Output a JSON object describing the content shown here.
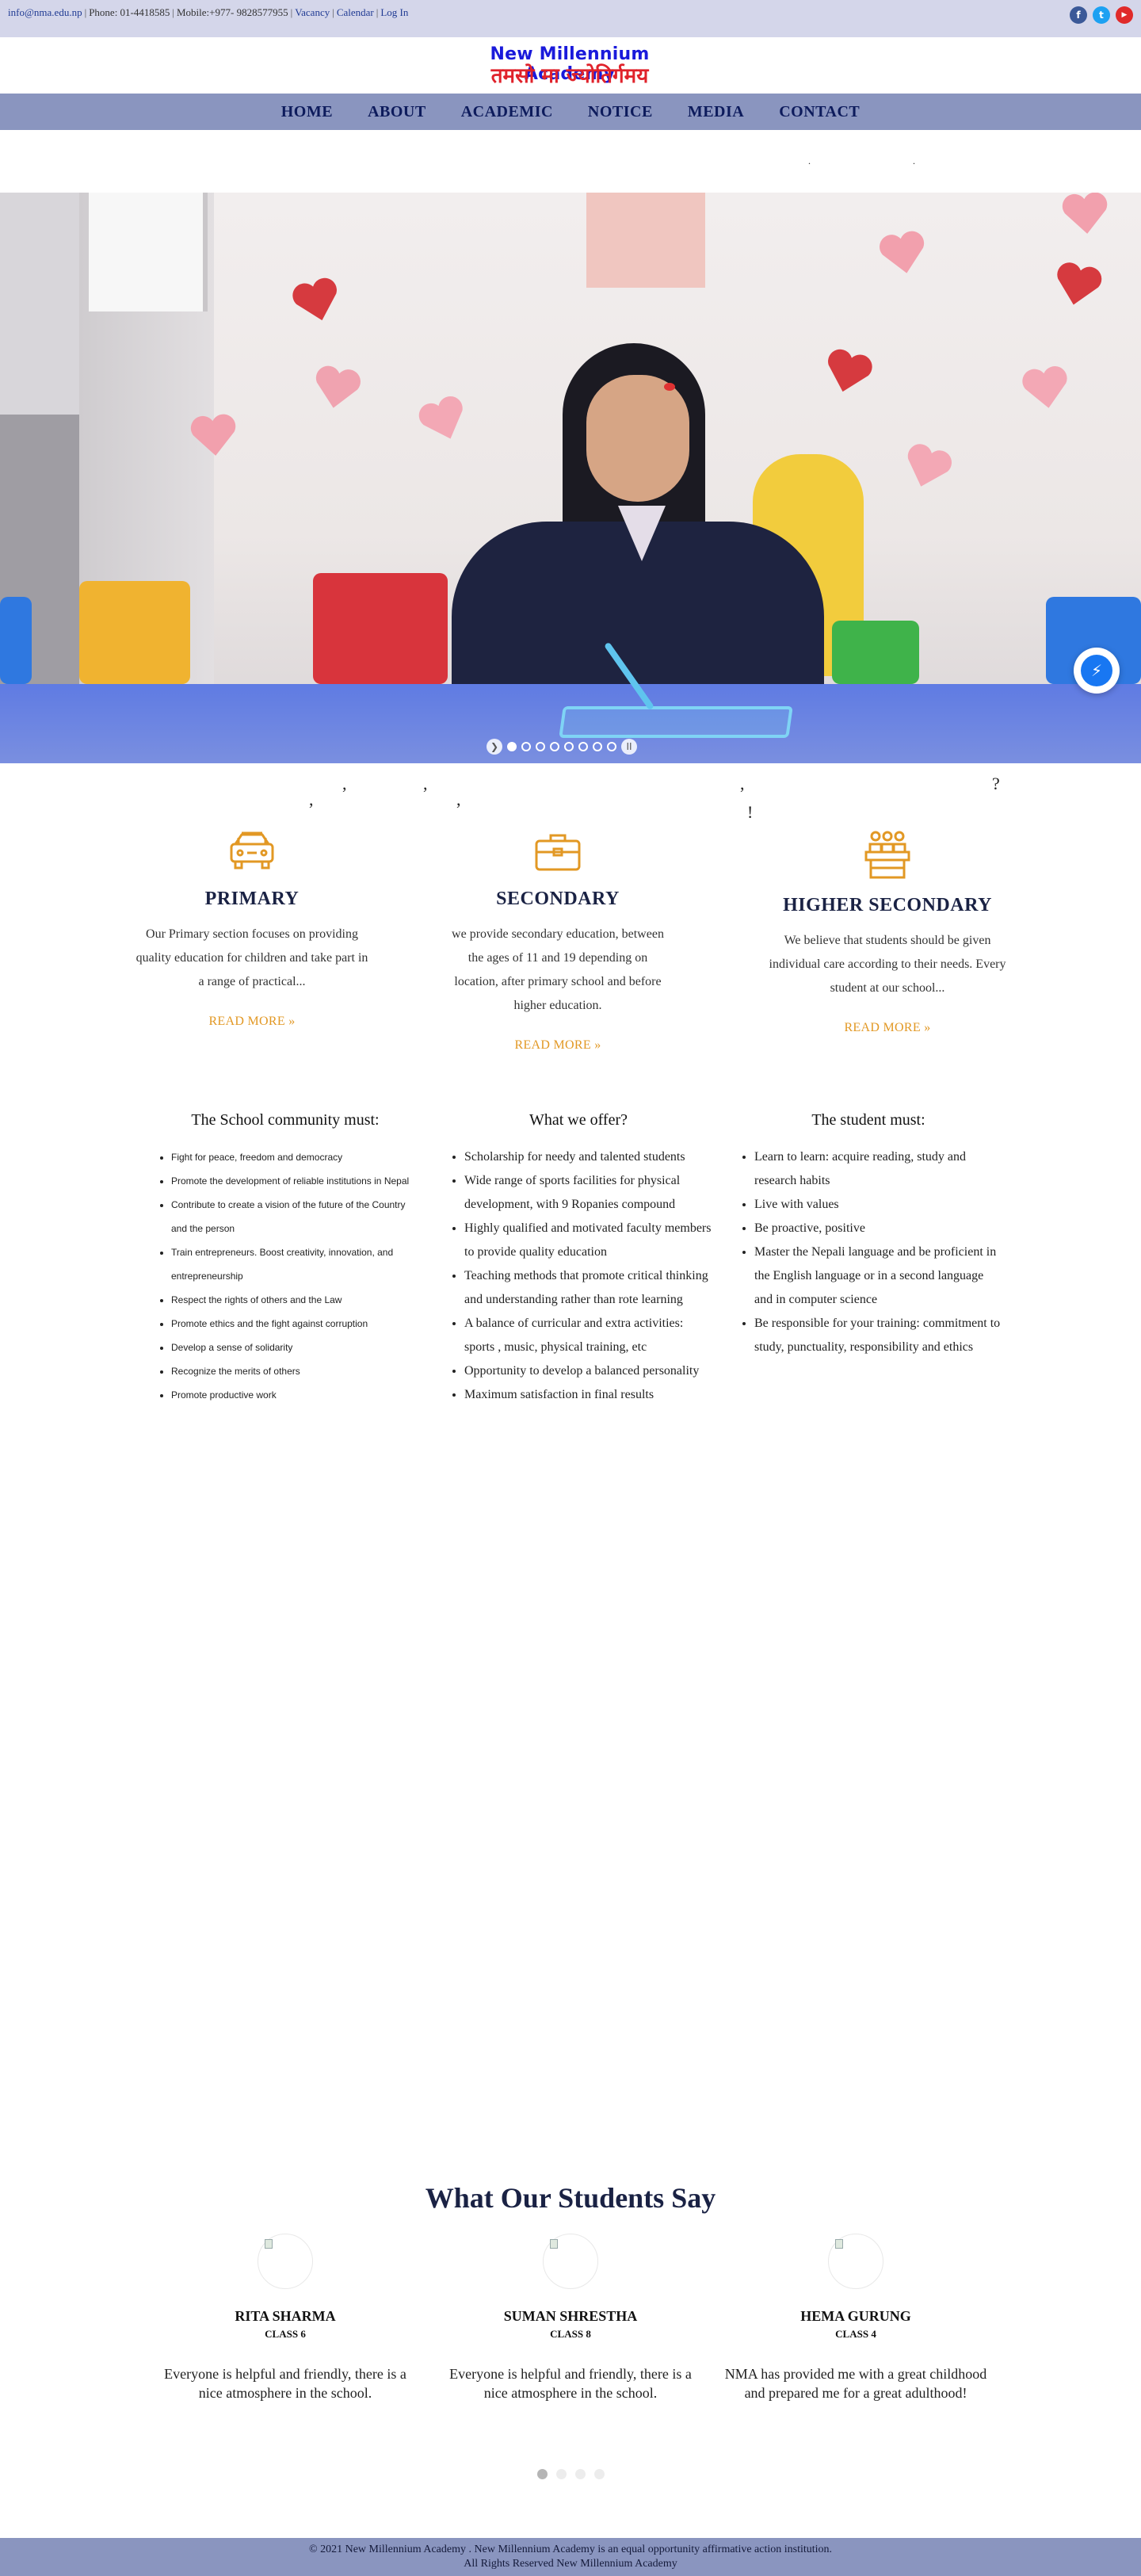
{
  "topbar": {
    "email": "info@nma.edu.np",
    "phone": "Phone: 01-4418585",
    "mobile": "Mobile:+977- 9828577955",
    "vacancy": "Vacancy",
    "calendar": "Calendar",
    "login": "Log In",
    "social": [
      {
        "icon": "facebook-icon",
        "glyph": "f",
        "color": "#3b5998"
      },
      {
        "icon": "twitter-icon",
        "glyph": "t",
        "color": "#1da1f2"
      },
      {
        "icon": "youtube-icon",
        "glyph": "▶",
        "color": "#e02a2a"
      }
    ]
  },
  "logo": {
    "english": "New Millennium Academy",
    "nepali": "तमसो मा ज्योतिर्गमय"
  },
  "nav": [
    "HOME",
    "ABOUT",
    "ACADEMIC",
    "NOTICE",
    "MEDIA",
    "CONTACT"
  ],
  "hero": {
    "slide_count": 10,
    "active_slide": 0
  },
  "levels": [
    {
      "title": "PRIMARY",
      "text": "Our Primary section focuses on providing quality education for children and take part in a range of practical...",
      "more": "READ MORE »"
    },
    {
      "title": "SECONDARY",
      "text": "we provide secondary education, between the ages of 11 and 19 depending on location, after primary school and before higher education.",
      "more": "READ MORE »"
    },
    {
      "title": "HIGHER SECONDARY",
      "text": "We believe that students should be given individual care according to their needs. Every student at our school...",
      "more": "READ MORE »"
    }
  ],
  "community": {
    "title": "The School community must:",
    "items": [
      "Fight for peace, freedom and democracy",
      "Promote the development of reliable institutions in Nepal",
      "Contribute to create a vision of the future of the Country and the person",
      "Train entrepreneurs. Boost creativity, innovation, and entrepreneurship",
      "Respect the rights of others and the Law",
      "Promote ethics and the fight against corruption",
      "Develop a sense of solidarity",
      "Recognize the merits of others",
      "Promote productive work"
    ]
  },
  "offer": {
    "title": "What we offer?",
    "items": [
      "Scholarship for needy and talented students",
      "Wide range of sports facilities for physical development, with 9 Ropanies compound",
      "Highly qualified and motivated faculty members to provide quality education",
      "Teaching methods that promote critical thinking and understanding rather than rote learning",
      "A balance of curricular and extra activities: sports , music, physical training, etc",
      "Opportunity to develop a balanced personality",
      "Maximum satisfaction in final results"
    ]
  },
  "student": {
    "title": "The student must:",
    "items": [
      "Learn to learn: acquire reading, study and research habits",
      "Live with values",
      "Be proactive, positive",
      "Master the Nepali language and be proficient in the English language or in a second language and in computer science",
      "Be responsible for your training: commitment to study, punctuality, responsibility and ethics"
    ]
  },
  "testimonials": {
    "title": "What Our Students Say",
    "cards": [
      {
        "name": "RITA SHARMA",
        "class": "CLASS 6",
        "quote": "Everyone is helpful and friendly, there is a nice atmosphere in the school."
      },
      {
        "name": "SUMAN SHRESTHA",
        "class": "CLASS 8",
        "quote": "Everyone is helpful and friendly, there is a nice atmosphere in the school."
      },
      {
        "name": "HEMA GURUNG",
        "class": "CLASS 4",
        "quote": "NMA has provided me with a great childhood and prepared me for a great adulthood!"
      }
    ],
    "dot_count": 4,
    "active_dot": 0
  },
  "footer": {
    "line1": "© 2021 New Millennium Academy . New Millennium Academy is an equal opportunity affirmative action institution.",
    "line2": "All Rights Reserved New Millennium Academy"
  },
  "colors": {
    "topbar": "#d4d6ea",
    "nav": "#8a95bf",
    "accent": "#e29824",
    "heading": "#1a2244"
  }
}
